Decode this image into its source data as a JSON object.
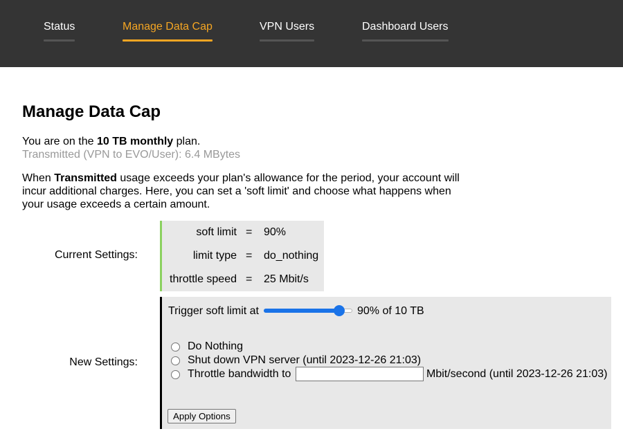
{
  "nav": {
    "tabs": [
      {
        "label": "Status",
        "active": false
      },
      {
        "label": "Manage Data Cap",
        "active": true
      },
      {
        "label": "VPN Users",
        "active": false
      },
      {
        "label": "Dashboard Users",
        "active": false
      }
    ]
  },
  "colors": {
    "topbar_bg": "#343434",
    "active_tab": "#f5a623",
    "current_settings_accent": "#8bd160",
    "slider_accent": "#1a73e8"
  },
  "page": {
    "title": "Manage Data Cap",
    "plan_prefix": "You are on the ",
    "plan_name": "10 TB monthly",
    "plan_suffix": " plan.",
    "transmitted": "Transmitted (VPN to EVO/User): 6.4 MBytes",
    "desc_prefix": "When ",
    "desc_bold": "Transmitted",
    "desc_suffix": " usage exceeds your plan's allowance for the period, your account will incur additional charges. Here, you can set a 'soft limit' and choose what happens when your usage exceeds a certain amount."
  },
  "current_settings": {
    "label": "Current Settings:",
    "rows": [
      {
        "key": "soft limit",
        "eq": "=",
        "value": "90%"
      },
      {
        "key": "limit type",
        "eq": "=",
        "value": "do_nothing"
      },
      {
        "key": "throttle speed",
        "eq": "=",
        "value": "25 Mbit/s"
      }
    ]
  },
  "new_settings": {
    "label": "New Settings:",
    "trigger_label": "Trigger soft limit at",
    "slider_percent": 90,
    "slider_value_text": "90% of 10 TB",
    "options": [
      {
        "label": "Do Nothing",
        "selected": false
      },
      {
        "label": "Shut down VPN server (until 2023-12-26 21:03)",
        "selected": false
      },
      {
        "label": "Throttle bandwidth to",
        "selected": false
      }
    ],
    "bandwidth_value": "",
    "bandwidth_unit": "Mbit/second (until 2023-12-26 21:03)",
    "apply_label": "Apply Options"
  }
}
